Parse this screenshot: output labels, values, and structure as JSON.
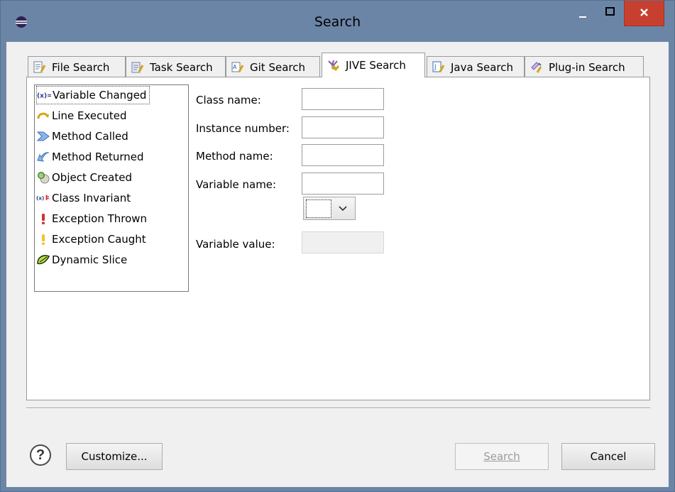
{
  "window": {
    "title": "Search",
    "colors": {
      "frame": "#6b85a7",
      "close": "#c7402f",
      "client": "#f0f0f0"
    }
  },
  "tabs": [
    {
      "label": "File Search",
      "icon": "file-search-icon",
      "active": false
    },
    {
      "label": "Task Search",
      "icon": "task-search-icon",
      "active": false
    },
    {
      "label": "Git Search",
      "icon": "git-search-icon",
      "active": false
    },
    {
      "label": "JIVE Search",
      "icon": "jive-search-icon",
      "active": true
    },
    {
      "label": "Java Search",
      "icon": "java-search-icon",
      "active": false
    },
    {
      "label": "Plug-in Search",
      "icon": "plugin-search-icon",
      "active": false
    }
  ],
  "events": [
    {
      "label": "Variable Changed",
      "icon": "variable-changed-icon",
      "selected": true
    },
    {
      "label": "Line Executed",
      "icon": "line-executed-icon"
    },
    {
      "label": "Method Called",
      "icon": "method-called-icon"
    },
    {
      "label": "Method Returned",
      "icon": "method-returned-icon"
    },
    {
      "label": "Object Created",
      "icon": "object-created-icon"
    },
    {
      "label": "Class Invariant",
      "icon": "class-invariant-icon"
    },
    {
      "label": "Exception Thrown",
      "icon": "exception-thrown-icon"
    },
    {
      "label": "Exception Caught",
      "icon": "exception-caught-icon"
    },
    {
      "label": "Dynamic Slice",
      "icon": "dynamic-slice-icon"
    }
  ],
  "form": {
    "class_name_label": "Class name:",
    "class_name_value": "",
    "instance_number_label": "Instance number:",
    "instance_number_value": "",
    "method_name_label": "Method name:",
    "method_name_value": "",
    "variable_name_label": "Variable name:",
    "variable_name_value": "",
    "operator_value": "",
    "variable_value_label": "Variable value:",
    "variable_value_value": ""
  },
  "buttons": {
    "customize": "Customize...",
    "search": "Search",
    "cancel": "Cancel"
  }
}
